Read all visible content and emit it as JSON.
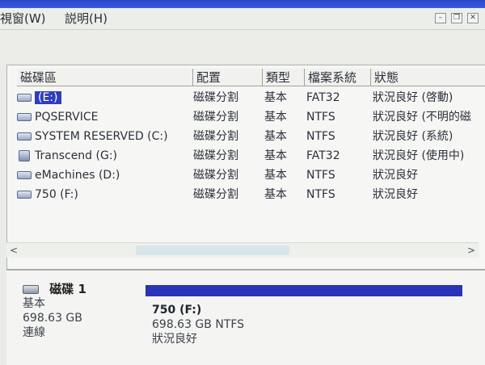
{
  "menu": {
    "view": "視窗(W)",
    "help": "説明(H)"
  },
  "columns": {
    "volume": "磁碟區",
    "layout": "配置",
    "type": "類型",
    "fs": "檔案系統",
    "status": "狀態"
  },
  "rows": [
    {
      "name": "(E:)",
      "layout": "磁碟分割",
      "type": "基本",
      "fs": "FAT32",
      "status": "狀況良好 (啓動)"
    },
    {
      "name": "PQSERVICE",
      "layout": "磁碟分割",
      "type": "基本",
      "fs": "NTFS",
      "status": "狀況良好 (不明的磁"
    },
    {
      "name": "SYSTEM RESERVED (C:)",
      "layout": "磁碟分割",
      "type": "基本",
      "fs": "NTFS",
      "status": "狀況良好 (系統)"
    },
    {
      "name": "Transcend (G:)",
      "layout": "磁碟分割",
      "type": "基本",
      "fs": "FAT32",
      "status": "狀況良好 (使用中)"
    },
    {
      "name": "eMachines (D:)",
      "layout": "磁碟分割",
      "type": "基本",
      "fs": "NTFS",
      "status": "狀況良好"
    },
    {
      "name": "750 (F:)",
      "layout": "磁碟分割",
      "type": "基本",
      "fs": "NTFS",
      "status": "狀況良好"
    }
  ],
  "disk": {
    "title": "磁碟 1",
    "type": "基本",
    "size": "698.63 GB",
    "state": "連線"
  },
  "partition": {
    "name": "750  (F:)",
    "detail": "698.63 GB NTFS",
    "status": "狀況良好"
  },
  "colors": {
    "titlebar": "#2c47c9",
    "partition_bar": "#2a34b6",
    "selection": "#2f3dbd"
  },
  "icons": {
    "volume": "drive-icon",
    "usb": "usb-drive-icon",
    "disk": "hard-disk-icon"
  }
}
